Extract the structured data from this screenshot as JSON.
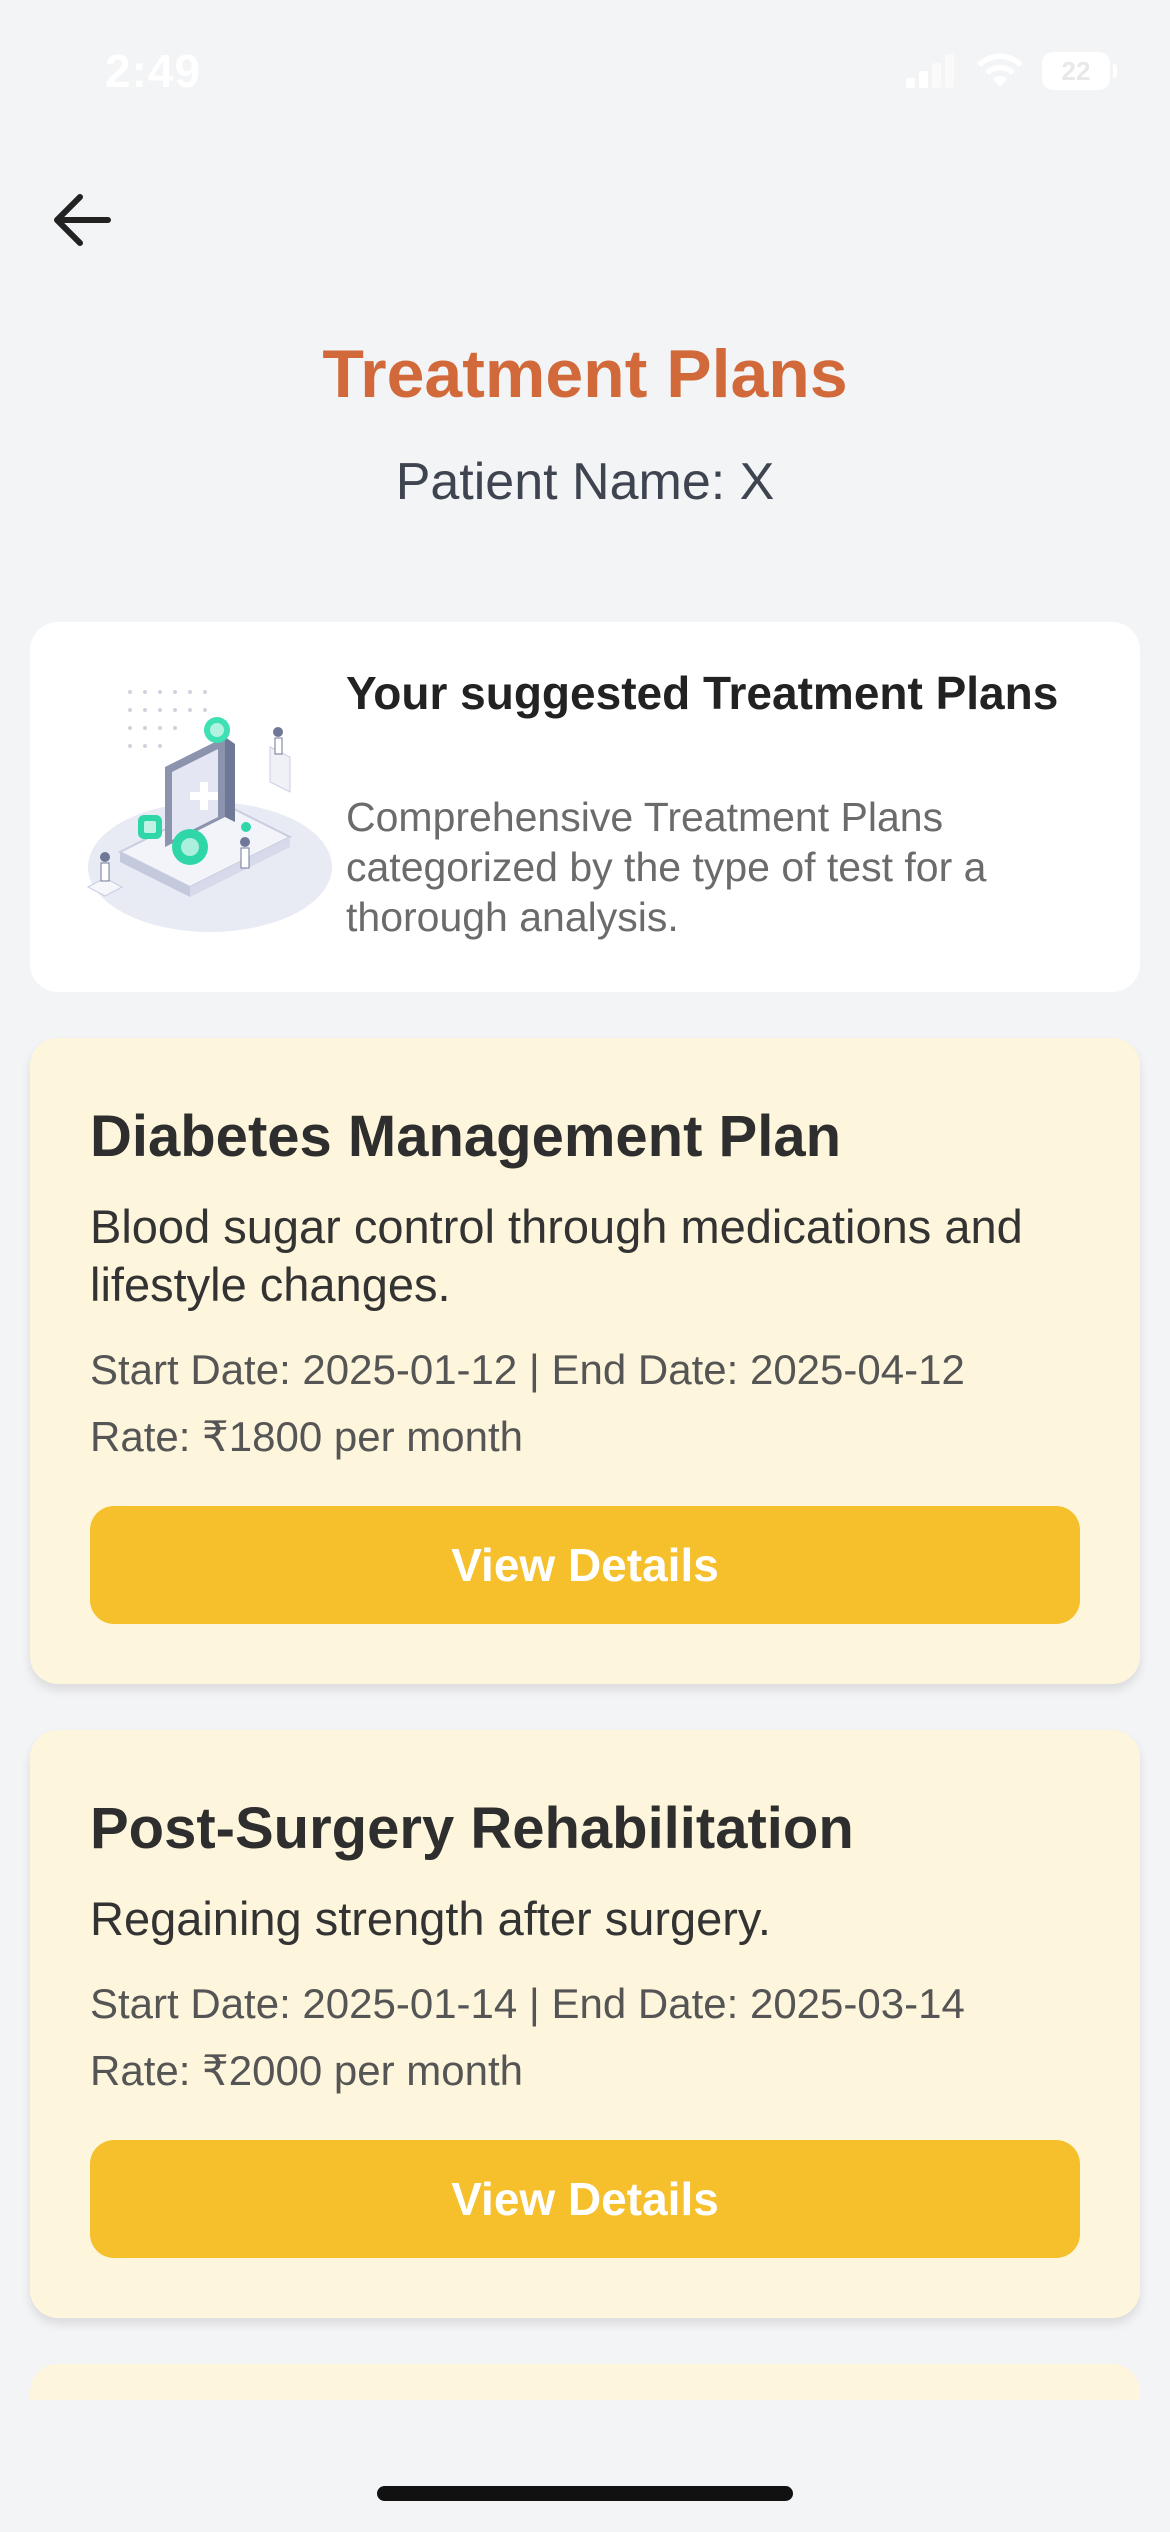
{
  "status_bar": {
    "time": "2:49",
    "battery_level": "22"
  },
  "header": {
    "back_icon": "arrow-left-icon",
    "title": "Treatment Plans",
    "patient_label": "Patient Name: X"
  },
  "intro_card": {
    "heading": "Your suggested Treatment Plans",
    "description": "Comprehensive Treatment Plans categorized by the type of test for a thorough analysis.",
    "illustration_icon": "medical-device-illustration"
  },
  "plans": [
    {
      "title": "Diabetes Management Plan",
      "description": "Blood sugar control through medications and lifestyle changes.",
      "dates": "Start Date: 2025-01-12 | End Date: 2025-04-12",
      "rate": "Rate: ₹1800 per month",
      "button_label": "View Details"
    },
    {
      "title": "Post-Surgery Rehabilitation",
      "description": "Regaining strength after surgery.",
      "dates": "Start Date: 2025-01-14 | End Date: 2025-03-14",
      "rate": "Rate: ₹2000 per month",
      "button_label": "View Details"
    }
  ],
  "colors": {
    "title_accent": "#d2693a",
    "card_background": "#fef6dc",
    "button_background": "#f5c02c",
    "page_background": "#f3f4f6"
  }
}
